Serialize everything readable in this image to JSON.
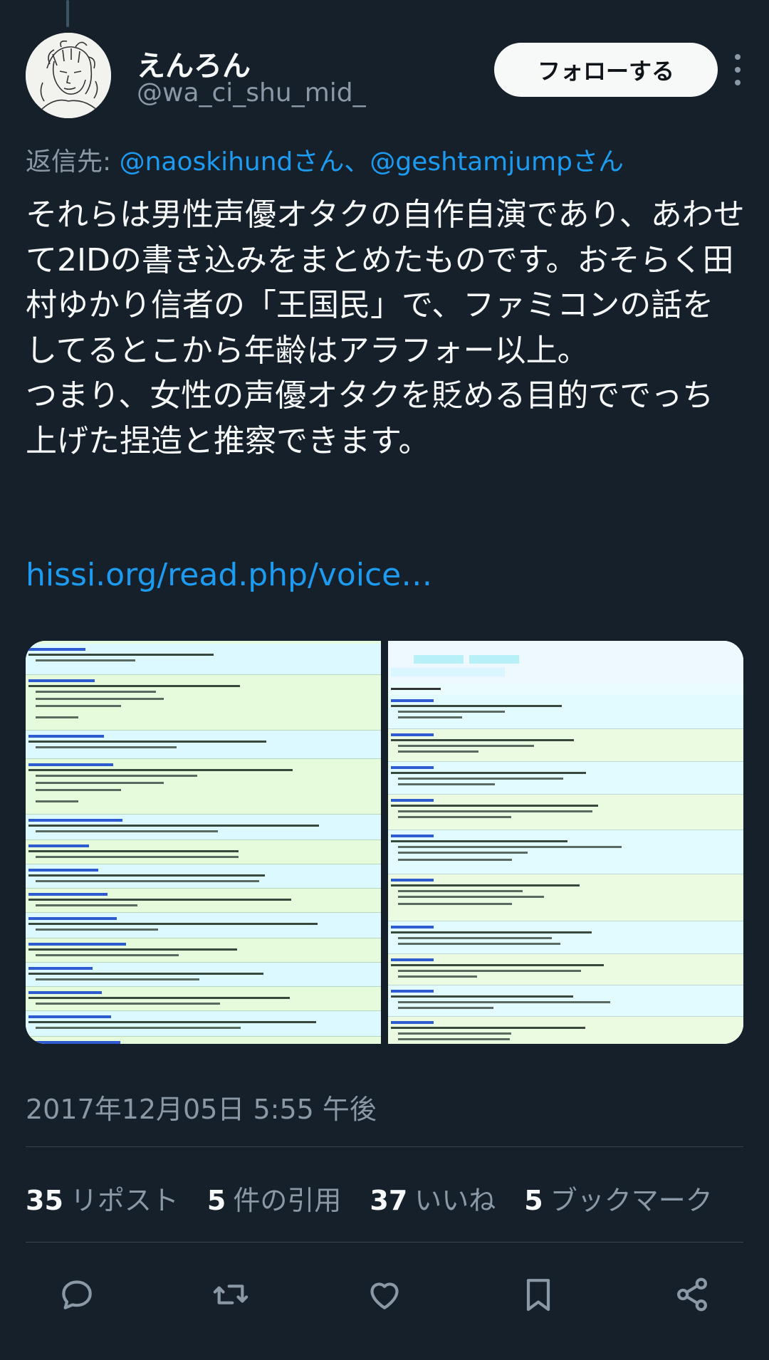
{
  "user": {
    "display_name": "えんろん",
    "handle": "@wa_ci_shu_mid_"
  },
  "header": {
    "follow_label": "フォローする",
    "more_icon": "more-vertical-icon"
  },
  "reply": {
    "prefix": "返信先: ",
    "mentions": "@naoskihundさん、@geshtamjumpさん"
  },
  "tweet": {
    "text": "それらは男性声優オタクの自作自演であり、あわせて2IDの書き込みをまとめたものです。おそらく田村ゆかり信者の「王国民」で、ファミコンの話をしてるとこから年齢はアラフォー以上。\nつまり、女性の声優オタクを貶める目的ででっち上げた捏造と推察できます。",
    "link": "hissi.org/read.php/voice…"
  },
  "timestamp": "2017年12月05日 5:55 午後",
  "stats": {
    "reposts_count": "35",
    "reposts_label": "リポスト",
    "quotes_count": "5",
    "quotes_label": "件の引用",
    "likes_count": "37",
    "likes_label": "いいね",
    "bookmarks_count": "5",
    "bookmarks_label": "ブックマーク"
  },
  "actions": [
    "reply-icon",
    "repost-icon",
    "like-icon",
    "bookmark-icon",
    "share-icon"
  ],
  "colors": {
    "background": "#15202b",
    "text": "#f7f9f9",
    "secondary": "#8b98a5",
    "accent": "#1d9bf0"
  }
}
